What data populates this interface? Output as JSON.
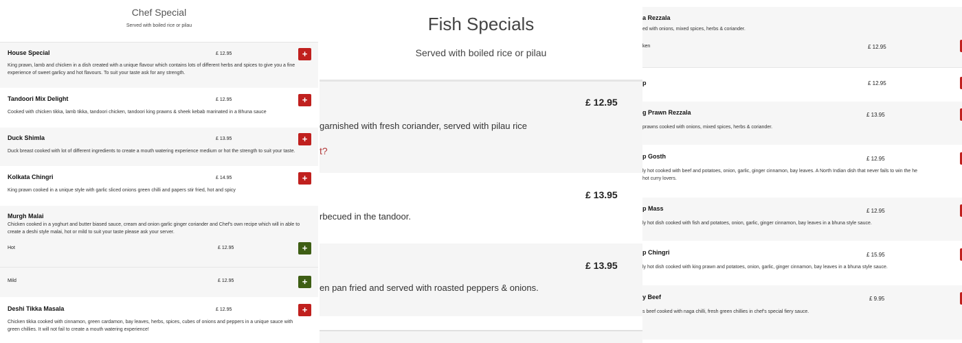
{
  "chef": {
    "title": "Chef Special",
    "subtitle": "Served with boiled rice or pilau",
    "add_icon": "plus-icon",
    "items": [
      {
        "name": "House Special",
        "price": "£ 12.95",
        "desc_lines": [
          "King prawn, lamb and chicken in a dish created with a unique flavour which contains lots of different herbs and spices to give you a fine",
          "experience of sweet garlicy and hot flavours. To suit your taste ask for any strength."
        ]
      },
      {
        "name": "Tandoori Mix Delight",
        "price": "£ 12.95",
        "desc_lines": [
          "Cooked with chicken tikka, lamb tikka, tandoori chicken, tandoori king prawns & sheek kebab marinated in a Bhuna sauce"
        ]
      },
      {
        "name": "Duck Shimla",
        "price": "£ 13.95",
        "desc_lines": [
          "Duck breast cooked with lot of different ingredients to create a mouth watering experience medium or hot the strength to suit your taste."
        ]
      },
      {
        "name": "Kolkata Chingri",
        "price": "£ 14.95",
        "desc_lines": [
          "King prawn cooked in a unique style with garlic sliced onions green chilli and papers stir fried, hot and spicy"
        ]
      },
      {
        "name": "Murgh Malai",
        "desc_lines": [
          "Chicken cooked in a yoghurt and butter biased sauce, cream and onion garlic ginger coriander and Chef's own recipe which will in able to",
          "create a deshi style malai, hot or mild to suit your taste please ask your server."
        ],
        "variants": [
          {
            "name": "Hot",
            "price": "£ 12.95"
          },
          {
            "name": "Mild",
            "price": "£ 12.95"
          }
        ]
      },
      {
        "name": "Deshi Tikka Masala",
        "price": "£ 12.95",
        "desc_lines": [
          "Chicken tikka cooked with cinnamon, green cardamon, bay leaves, herbs, spices, cubes of onions and peppers in a unique sauce with",
          "green chillies. It will not fail to create a mouth watering experience!"
        ]
      }
    ]
  },
  "fish": {
    "title": "Fish Specials",
    "subtitle": "Served with boiled rice or pilau",
    "items": [
      {
        "price": "£ 12.95",
        "desc": "garnished with fresh coriander, served with pilau rice",
        "extra": "t?"
      },
      {
        "price": "£ 13.95",
        "desc": "rbecued in the tandoor."
      },
      {
        "price": "£ 13.95",
        "desc": "en pan fried and served with roasted peppers & onions."
      }
    ]
  },
  "right": {
    "items": [
      {
        "name": "a Rezzala",
        "desc": "ed with onions, mixed spices, herbs & coriander.",
        "variant": "ken",
        "price": "£ 12.95"
      },
      {
        "name": "p",
        "price": "£ 12.95"
      },
      {
        "name": "g Prawn Rezzala",
        "price": "£ 13.95",
        "desc_lines": [
          "prawns cooked with onions, mixed spices, herbs & coriander."
        ]
      },
      {
        "name": "p Gosth",
        "price": "£ 12.95",
        "desc_lines": [
          "ly hot cooked with beef and potatoes, onion, garlic, ginger cinnamon, bay leaves. A North Indian dish that never fails to win the he",
          "hot curry lovers."
        ]
      },
      {
        "name": "p Mass",
        "price": "£ 12.95",
        "desc_lines": [
          "ly hot dish cooked with fish and potatoes, onion, garlic, ginger cinnamon, bay leaves in a bhuna style sauce."
        ]
      },
      {
        "name": "p Chingri",
        "price": "£ 15.95",
        "desc_lines": [
          "ly hot dish cooked with king prawn and potatoes, onion, garlic, ginger cinnamon, bay leaves in a bhuna style sauce."
        ]
      },
      {
        "name": "y Beef",
        "price": "£ 9.95",
        "desc_lines": [
          "s beef cooked with naga chilli, fresh green chillies in chef's special fiery sauce."
        ]
      }
    ]
  }
}
